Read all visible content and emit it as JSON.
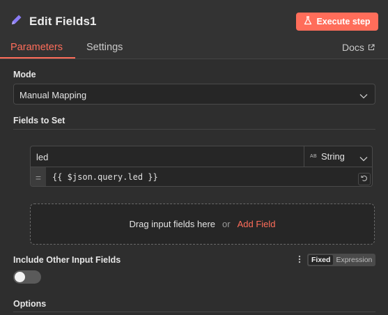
{
  "header": {
    "title": "Edit Fields1",
    "execute_label": "Execute step"
  },
  "tabs": [
    {
      "label": "Parameters",
      "active": true
    },
    {
      "label": "Settings",
      "active": false
    }
  ],
  "docs_label": "Docs",
  "mode": {
    "label": "Mode",
    "value": "Manual Mapping"
  },
  "fields_to_set": {
    "label": "Fields to Set",
    "field": {
      "name": "led",
      "type_badge": "AB",
      "type": "String",
      "value": "{{ $json.query.led }}"
    },
    "dropzone": {
      "text": "Drag input fields here",
      "or": "or",
      "add_label": "Add Field"
    }
  },
  "include_other": {
    "label": "Include Other Input Fields",
    "enabled": false,
    "mode_fixed": "Fixed",
    "mode_expression": "Expression"
  },
  "options": {
    "label": "Options"
  },
  "colors": {
    "accent": "#ff6d5a",
    "background": "#2e2e2e",
    "input_bg": "#262626"
  }
}
